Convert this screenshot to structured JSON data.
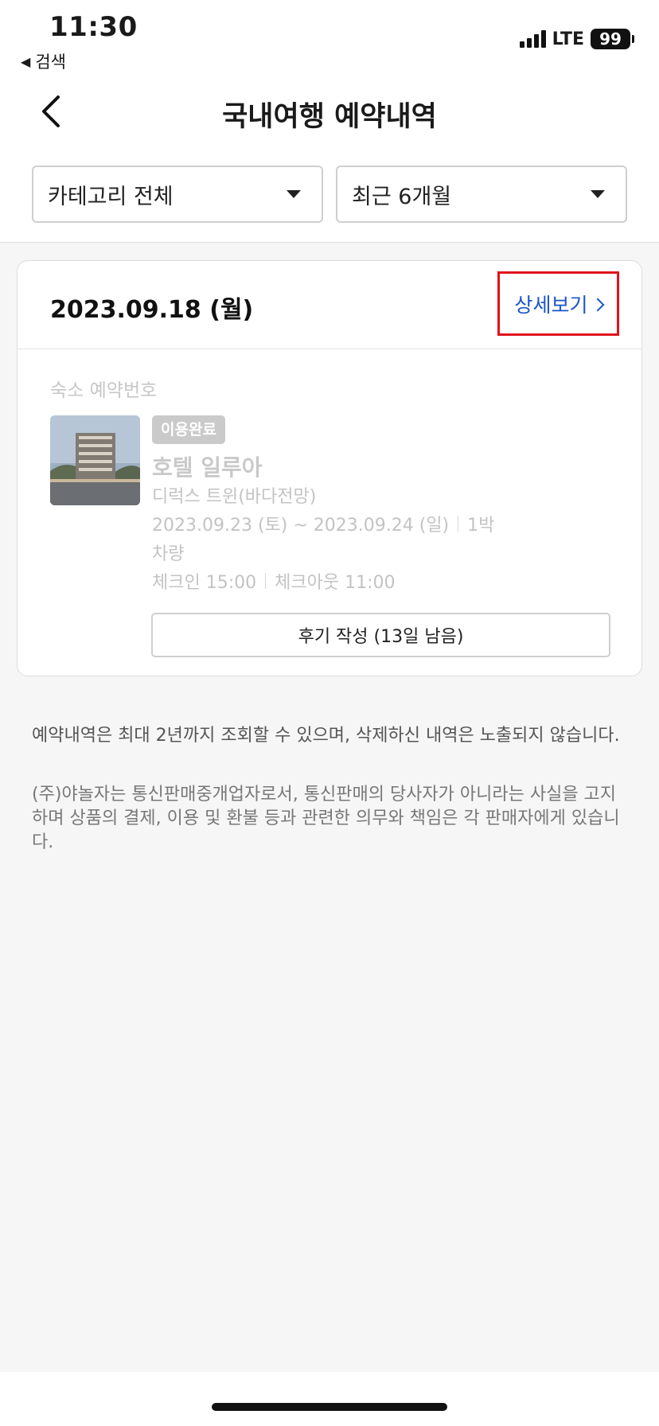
{
  "status_bar": {
    "time": "11:30",
    "back_app": "검색",
    "network": "LTE",
    "battery": "99"
  },
  "nav": {
    "title": "국내여행 예약내역"
  },
  "filters": {
    "category": "카테고리 전체",
    "period": "최근 6개월"
  },
  "reservation": {
    "date": "2023.09.18 (월)",
    "detail_label": "상세보기",
    "reservation_no_label": "숙소 예약번호",
    "status_badge": "이용완료",
    "hotel_name": "호텔 일루아",
    "room_type": "디럭스 트윈(바다전망)",
    "stay_dates": "2023.09.23 (토) ~ 2023.09.24 (일)",
    "nights": "1박",
    "vehicle": "차량",
    "checkin": "체크인 15:00",
    "checkout": "체크아웃 11:00",
    "review_button": "후기 작성 (13일 남음)"
  },
  "notes": {
    "retention": "예약내역은 최대 2년까지 조회할 수 있으며, 삭제하신 내역은 노출되지 않습니다.",
    "disclaimer": "(주)야놀자는 통신판매중개업자로서, 통신판매의 당사자가 아니라는 사실을 고지하며 상품의 결제, 이용 및 환불 등과 관련한 의무와 책임은 각 판매자에게 있습니다."
  },
  "colors": {
    "accent_link": "#1a55c8",
    "highlight_box": "#e0111b",
    "badge_bg": "#cacaca"
  }
}
